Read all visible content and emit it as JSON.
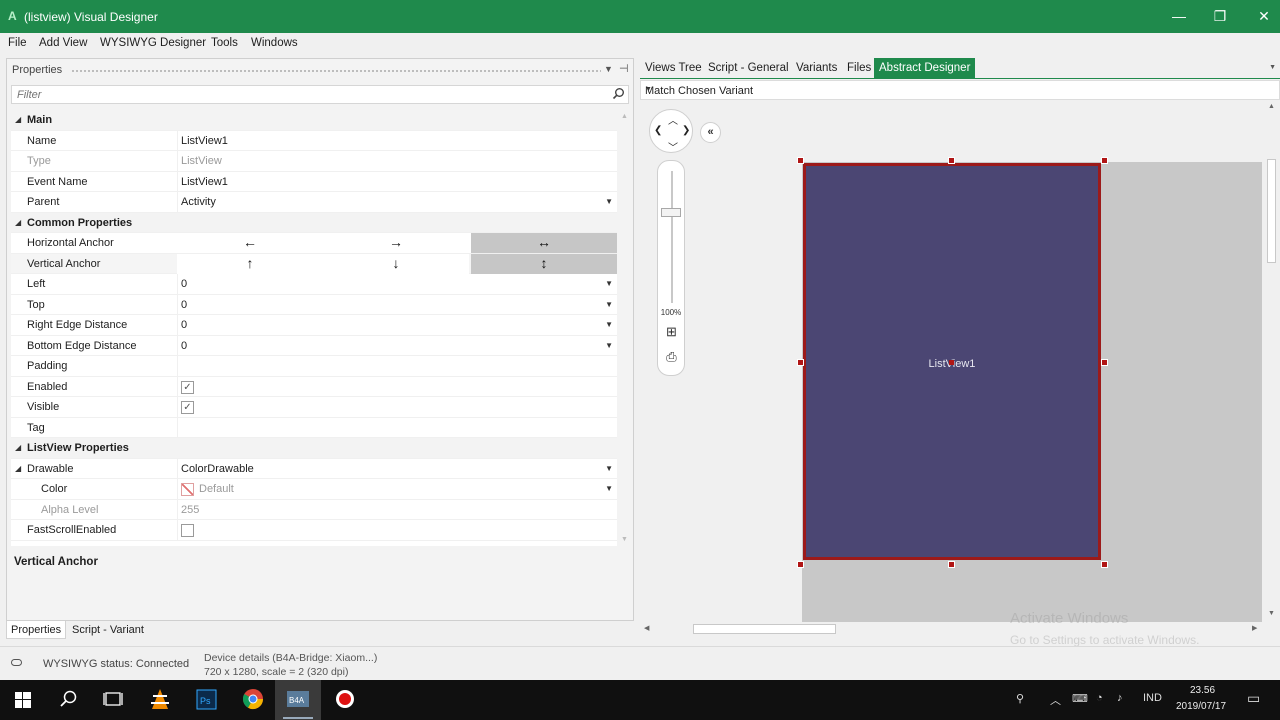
{
  "window": {
    "title": "(listview) Visual Designer",
    "app_icon": "A",
    "controls": {
      "minimize": "—",
      "restore": "❐",
      "close": "✕"
    }
  },
  "menu": [
    "File",
    "Add View",
    "WYSIWYG Designer",
    "Tools",
    "Windows"
  ],
  "properties": {
    "header": "Properties",
    "filter_placeholder": "Filter",
    "rows": {
      "main": "Main",
      "name_label": "Name",
      "name_value": "ListView1",
      "type_label": "Type",
      "type_value": "ListView",
      "event_label": "Event Name",
      "event_value": "ListView1",
      "parent_label": "Parent",
      "parent_value": "Activity",
      "common": "Common Properties",
      "h_anchor_label": "Horizontal Anchor",
      "v_anchor_label": "Vertical Anchor",
      "left_label": "Left",
      "left_value": "0",
      "top_label": "Top",
      "top_value": "0",
      "right_label": "Right Edge Distance",
      "right_value": "0",
      "bottom_label": "Bottom Edge Distance",
      "bottom_value": "0",
      "padding_label": "Padding",
      "enabled_label": "Enabled",
      "visible_label": "Visible",
      "tag_label": "Tag",
      "lv_props": "ListView Properties",
      "drawable_label": "Drawable",
      "drawable_value": "ColorDrawable",
      "color_label": "Color",
      "color_value": "Default",
      "alpha_label": "Alpha Level",
      "alpha_value": "255",
      "fastscroll_label": "FastScrollEnabled"
    },
    "checks": {
      "enabled": true,
      "visible": true,
      "fastscroll": false
    },
    "h_anchor": [
      "←",
      "→",
      "↔"
    ],
    "v_anchor": [
      "↑",
      "↓",
      "↕"
    ],
    "description_title": "Vertical Anchor"
  },
  "bottom_tabs": [
    "Properties",
    "Script - Variant"
  ],
  "designer": {
    "tabs": [
      "Views Tree",
      "Script - General",
      "Variants",
      "Files",
      "Abstract Designer"
    ],
    "variant_select": "Match Chosen Variant",
    "view_label": "ListView1",
    "zoom": "100%",
    "colors": {
      "device_fill": "#4b4673",
      "selection": "#9c1a1a",
      "accent": "#1f8a4c"
    }
  },
  "watermark": {
    "line1": "Activate Windows",
    "line2": "Go to Settings to activate Windows."
  },
  "status": {
    "connection": "WYSIWYG status: Connected",
    "device_line1": "Device details (B4A-Bridge: Xiaom...)",
    "device_line2": "720 x 1280, scale = 2 (320 dpi)"
  },
  "taskbar": {
    "language": "IND",
    "time": "23.56",
    "date": "2019/07/17",
    "apps": [
      "windows-start-icon",
      "search-icon",
      "task-view-icon",
      "vlc-icon",
      "photoshop-icon",
      "chrome-icon",
      "b4a-icon",
      "record-icon"
    ],
    "photoshop_label": "Ps",
    "b4a_label": "B4A"
  }
}
